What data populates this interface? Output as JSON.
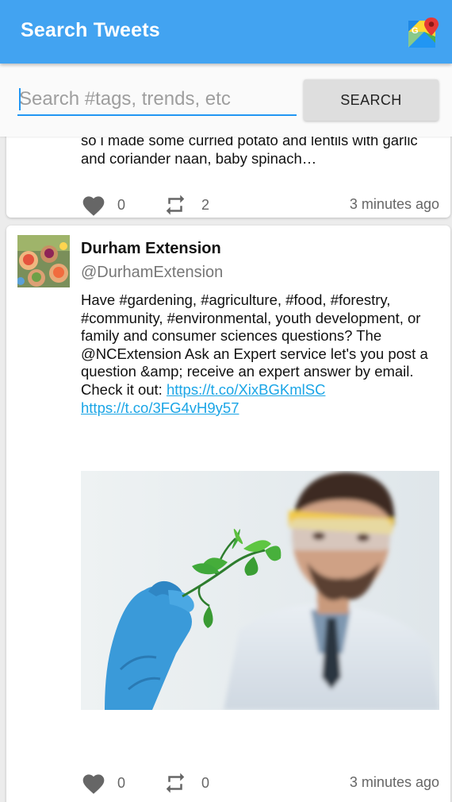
{
  "appbar": {
    "title": "Search Tweets",
    "maps_icon": "google-maps-icon",
    "color": "#42a3f1"
  },
  "search": {
    "placeholder": "Search #tags, trends, etc",
    "value": "",
    "button_label": "SEARCH",
    "accent": "#2196f3"
  },
  "tweets": [
    {
      "text": "so i made some curried potato and lentils with garlic and coriander naan, baby spinach…",
      "likes": "0",
      "retweets": "2",
      "time": "3 minutes ago"
    },
    {
      "name": "Durham Extension",
      "handle": "@DurhamExtension",
      "text": "Have #gardening, #agriculture, #food, #forestry, #community, #environmental, youth development, or family and consumer sciences questions? The @NCExtension Ask an Expert service let's you post a question &amp; receive an expert answer by email. Check it out: ",
      "link1": "https://t.co/XixBGKmlSC",
      "link2": "https://t.co/3FG4vH9y57",
      "likes": "0",
      "retweets": "0",
      "time": "3 minutes ago"
    }
  ],
  "icons": {
    "like": "heart-icon",
    "retweet": "retweet-icon"
  },
  "colors": {
    "link": "#1aa5e6",
    "icon_gray": "#666666",
    "background": "#ececec"
  }
}
